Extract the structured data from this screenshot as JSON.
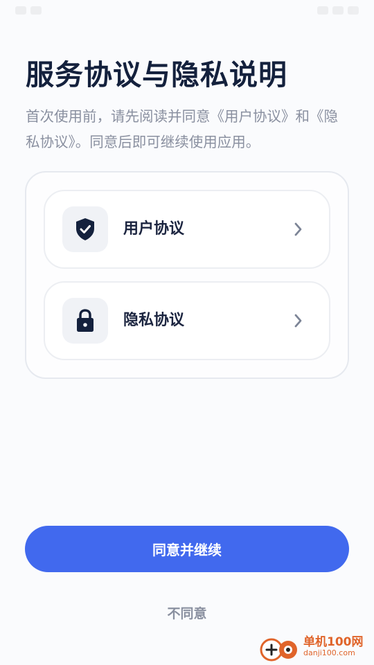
{
  "title": "服务协议与隐私说明",
  "subtitle": "首次使用前，请先阅读并同意《用户协议》和《隐私协议》。同意后即可继续使用应用。",
  "agreements": [
    {
      "label": "用户协议",
      "icon": "shield-check-icon"
    },
    {
      "label": "隐私协议",
      "icon": "lock-icon"
    }
  ],
  "actions": {
    "agree_label": "同意并继续",
    "disagree_label": "不同意"
  },
  "watermark": {
    "name": "单机100网",
    "url": "danji100.com"
  },
  "colors": {
    "primary": "#4169ee",
    "title": "#14213d",
    "muted": "#8a90a0",
    "icon": "#14213d",
    "watermark": "#e0642a"
  }
}
